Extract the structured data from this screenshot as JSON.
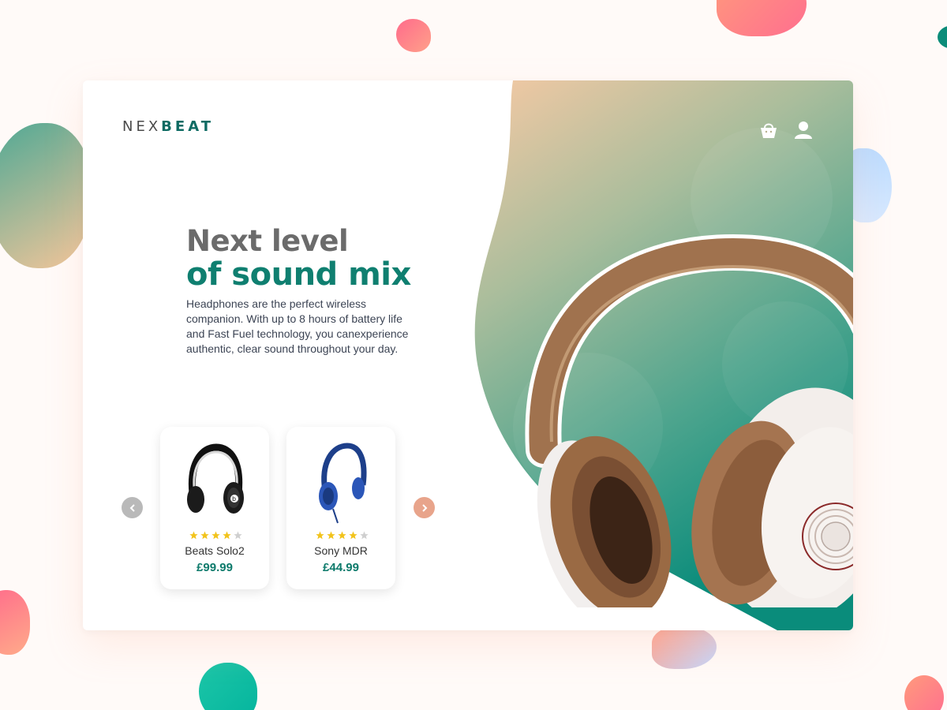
{
  "brand": {
    "light": "NEX",
    "strong": "BEAT"
  },
  "header": {
    "cart_icon": "shopping-bag-icon",
    "user_icon": "user-icon"
  },
  "hero": {
    "headline_line1": "Next level",
    "headline_line2": "of sound mix",
    "description": "Headphones are the perfect wireless companion. With up to 8 hours of battery life and Fast Fuel technology, you canexperience authentic, clear sound throughout your day."
  },
  "carousel": {
    "prev_icon": "chevron-left-icon",
    "next_icon": "chevron-right-icon",
    "products": [
      {
        "name": "Beats Solo2",
        "price": "£99.99",
        "rating": 4,
        "max_rating": 5
      },
      {
        "name": "Sony MDR",
        "price": "£44.99",
        "rating": 4,
        "max_rating": 5
      }
    ]
  },
  "colors": {
    "brand_green": "#0f7f70",
    "accent_peach": "#e8a48b",
    "star_gold": "#f2c31b",
    "star_empty": "#cfcfcf"
  }
}
